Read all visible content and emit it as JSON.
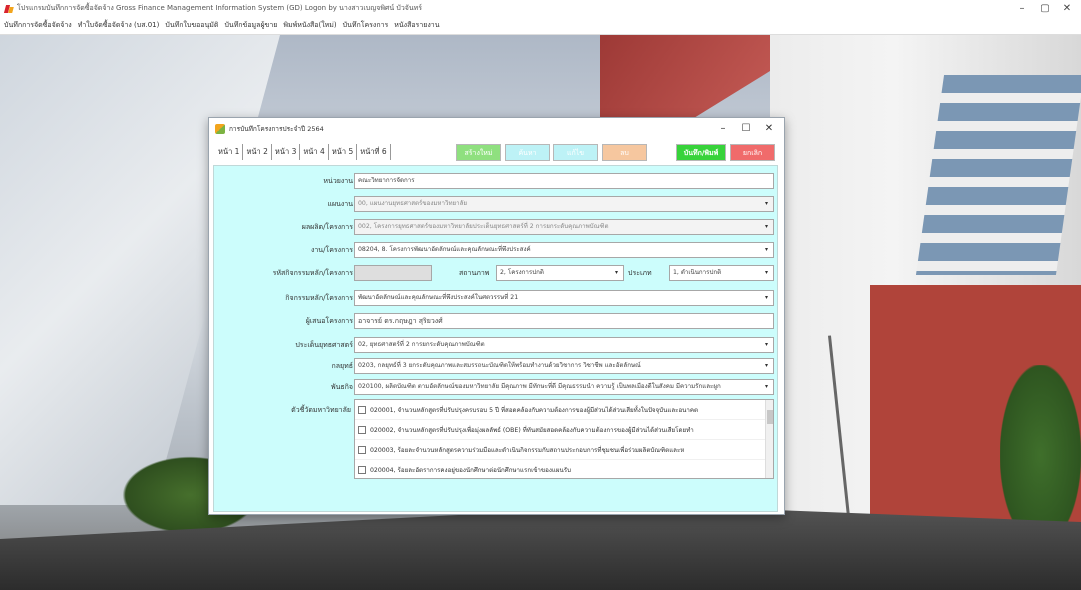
{
  "app": {
    "title": "โปรแกรมบันทึกการจัดซื้อจัดจ้าง Gross Finance Management Information System (GD) Logon by นางสาวเบญจพิศน์ บัวจันทร์",
    "menu": [
      "บันทึกการจัดซื้อจัดจ้าง",
      "ทำใบจัดซื้อจัดจ้าง (บส.01)",
      "บันทึกใบขออนุมัติ",
      "บันทึกข้อมูลผู้ขาย",
      "พิมพ์หนังสือ(ใหม่)",
      "บันทึกโครงการ",
      "หนังสือรายงาน"
    ],
    "controls": {
      "minimize": "–",
      "maximize": "▢",
      "close": "✕"
    }
  },
  "dialog": {
    "title": "การบันทึกโครงการประจำปี 2564",
    "controls": {
      "minimize": "–",
      "maximize": "☐",
      "close": "✕"
    },
    "tabs": [
      "หน้า 1",
      "หน้า 2",
      "หน้า 3",
      "หน้า 4",
      "หน้า 5",
      "หน้าที่ 6"
    ],
    "buttons": {
      "new": "สร้างใหม่",
      "search": "ค้นหา",
      "edit": "แก้ไข",
      "delete": "ลบ",
      "save_print": "บันทึก/พิมพ์",
      "cancel": "ยกเลิก"
    },
    "form": {
      "unit": {
        "label": "หน่วยงาน",
        "value": "คณะวิทยาการจัดการ"
      },
      "plan": {
        "label": "แผนงาน",
        "value": "00, แผนงานยุทธศาสตร์ของมหาวิทยาลัย"
      },
      "output": {
        "label": "ผลผลิต/โครงการ",
        "value": "002, โครงการยุทธศาสตร์ของมหาวิทยาลัยประเด็นยุทธศาสตร์ที่ 2 การยกระดับคุณภาพบัณฑิต"
      },
      "project": {
        "label": "งาน/โครงการ",
        "value": "08204, 8. โครงการพัฒนาอัตลักษณ์และคุณลักษณะที่พึงประสงค์"
      },
      "activity_code": {
        "label": "รหัสกิจกรรมหลัก/โครงการ",
        "value": ""
      },
      "status": {
        "label": "สถานภาพ",
        "value": "2, โครงการปกติ"
      },
      "type": {
        "label": "ประเภท",
        "value": "1, ดำเนินการปกติ"
      },
      "main_activity": {
        "label": "กิจกรรมหลัก/โครงการ",
        "value": "พัฒนาอัตลักษณ์และคุณลักษณะที่พึงประสงค์ในศตวรรษที่ 21"
      },
      "proposer": {
        "label": "ผู้เสนอโครงการ",
        "value": "อาจารย์ ดร.กฤษฎา สุริยวงศ์"
      },
      "strategy": {
        "label": "ประเด็นยุทธศาสตร์",
        "value": "02, ยุทธศาสตร์ที่ 2 การยกระดับคุณภาพบัณฑิต"
      },
      "tactic": {
        "label": "กลยุทธ์",
        "value": "0203, กลยุทธ์ที่ 3 ยกระดับคุณภาพและสมรรถนะบัณฑิตให้พร้อมทำงานด้วยวิชาการ วิชาชีพ และอัตลักษณ์"
      },
      "mission": {
        "label": "พันธกิจ",
        "value": "020100, ผลิตบัณฑิต ตามอัตลักษณ์ของมหาวิทยาลัย มีคุณภาพ มีทักษะที่ดี มีคุณธรรมนำ ความรู้ เป็นพลเมืองดีในสังคม มีความรักและผูก"
      },
      "indicators": {
        "label": "ตัวชี้วัดมหาวิทยาลัย",
        "items": [
          "020001, จำนวนหลักสูตรที่ปรับปรุงครบรอบ 5 ปี ที่สอดคล้องกับความต้องการของผู้มีส่วนได้ส่วนเสียทั้งในปัจจุบันและอนาคต",
          "020002, จำนวนหลักสูตรที่ปรับปรุงเพื่อมุ่งผลลัพธ์ (OBE) ที่ทันสมัยสอดคล้องกับความต้องการของผู้มีส่วนได้ส่วนเสียโดยทำ",
          "020003, ร้อยละจำนวนหลักสูตรความร่วมมือและดำเนินกิจกรรมกับสถานประกอบการที่ชุมชนเพื่อร่วมผลิตบัณฑิตและห",
          "020004, ร้อยละอัตราการคงอยู่ของนักศึกษาต่อนักศึกษาแรกเข้าของแผนรับ"
        ]
      }
    }
  },
  "colors": {
    "form_bg": "#ccfdfc",
    "save_button": "#37d33a",
    "cancel_button": "#f06b6b",
    "new_button": "#8fe07f",
    "delete_button": "#f6c79f"
  }
}
